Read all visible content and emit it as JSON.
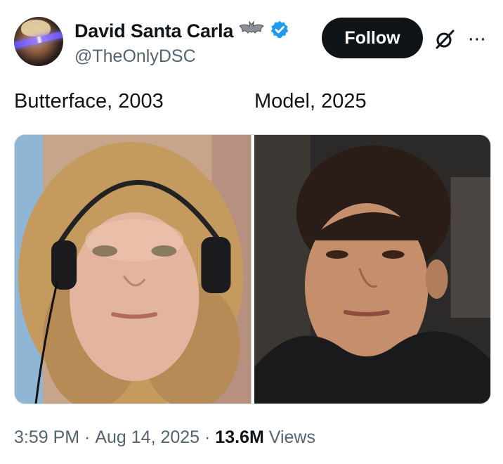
{
  "author": {
    "display_name": "David Santa Carla",
    "handle": "@TheOnlyDSC",
    "emoji": "bat-emoji",
    "verified": true,
    "verified_color": "#1d9bf0"
  },
  "actions": {
    "follow_label": "Follow"
  },
  "post": {
    "caption_left": "Butterface, 2003",
    "caption_right": "Model, 2025"
  },
  "meta": {
    "time": "3:59 PM",
    "separator": " · ",
    "date": "Aug 14, 2025",
    "views_count": "13.6M",
    "views_label": " Views"
  },
  "icons": [
    "bat-emoji-icon",
    "verified-badge-icon",
    "grok-icon",
    "more-icon"
  ]
}
